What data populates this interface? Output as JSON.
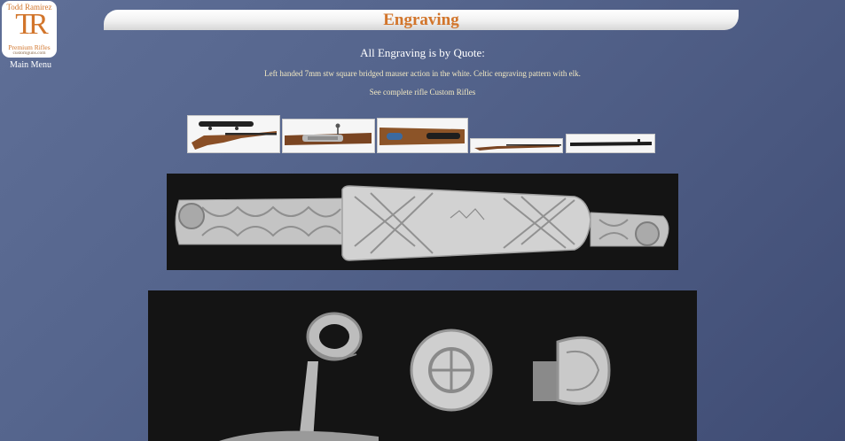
{
  "logo": {
    "name": "Todd Ramirez",
    "monogram": "TR",
    "tagline": "Premium Rifles",
    "url": "customguns.com"
  },
  "nav": {
    "main_menu": "Main Menu"
  },
  "page": {
    "title": "Engraving",
    "quote_heading": "All Engraving is by Quote:",
    "description": "Left handed 7mm stw square bridged mauser action in the white. Celtic engraving pattern with elk.",
    "see_rifle_link": "See complete rifle Custom Rifles"
  },
  "colors": {
    "accent": "#d2752b",
    "text_light": "#f3e9c2",
    "background": "#55658d"
  }
}
